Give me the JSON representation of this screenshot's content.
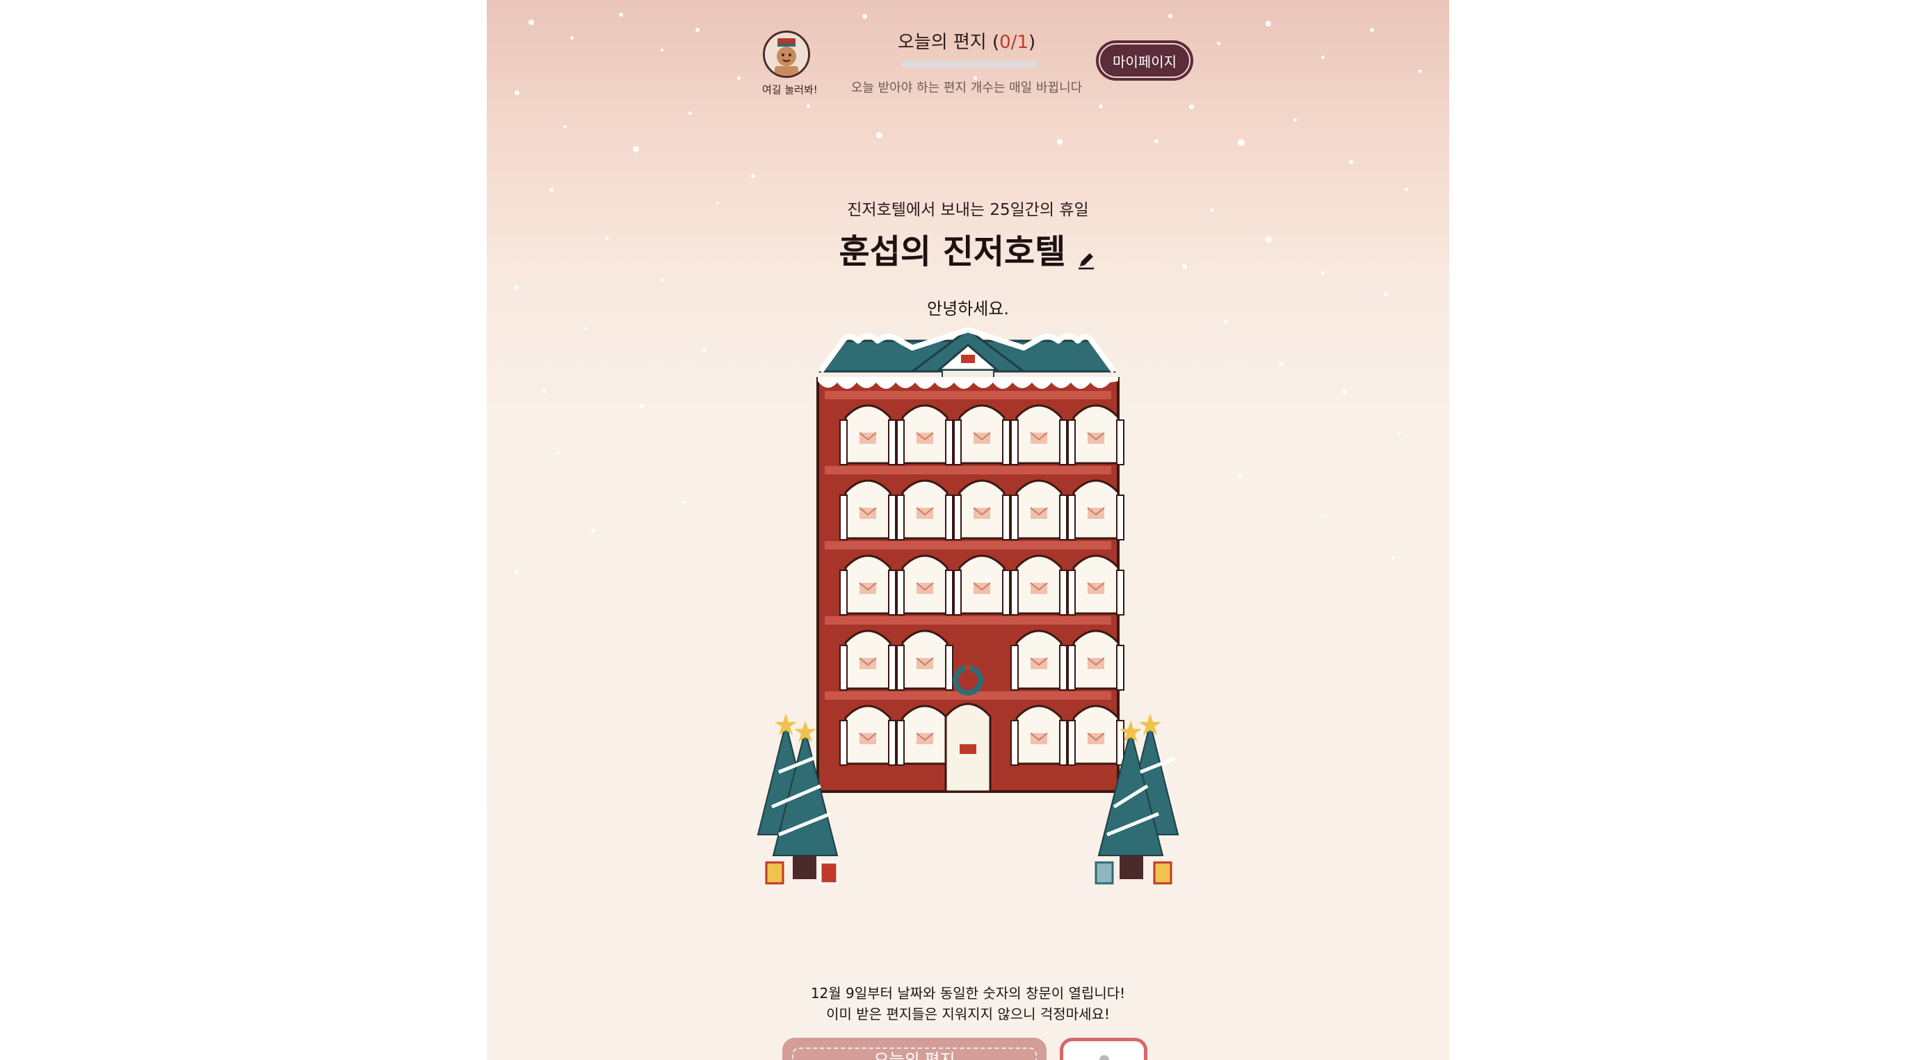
{
  "header": {
    "avatar_caption": "여길 눌러봐!",
    "letter_title_prefix": "오늘의 편지 (",
    "letter_count": "0/1",
    "letter_title_suffix": ")",
    "letter_progress": 0,
    "letter_subtitle": "오늘 받아야 하는 편지 개수는 매일 바뀝니다",
    "mypage_label": "마이페이지"
  },
  "hotel": {
    "subtitle": "진저호텔에서 보내는 25일간의 휴일",
    "title": "훈섭의 진저호텔",
    "greeting": "안녕하세요."
  },
  "notice": {
    "line1": "12월 9일부터 날짜와 동일한 숫자의 창문이 열립니다!",
    "line2": "이미 받은 편지들은 지워지지 않으니 걱정마세요!"
  },
  "buttons": {
    "today_letter_label": "오늘의 편지"
  },
  "icons": {
    "edit": "pencil-icon",
    "share": "share-icon",
    "avatar": "gingerbread-avatar-icon"
  },
  "colors": {
    "hotel_red": "#a8352a",
    "roof_teal": "#2f6c74",
    "button_plum": "#5b2c3a",
    "button_pink": "#d39e98",
    "accent_red": "#c0392b"
  }
}
